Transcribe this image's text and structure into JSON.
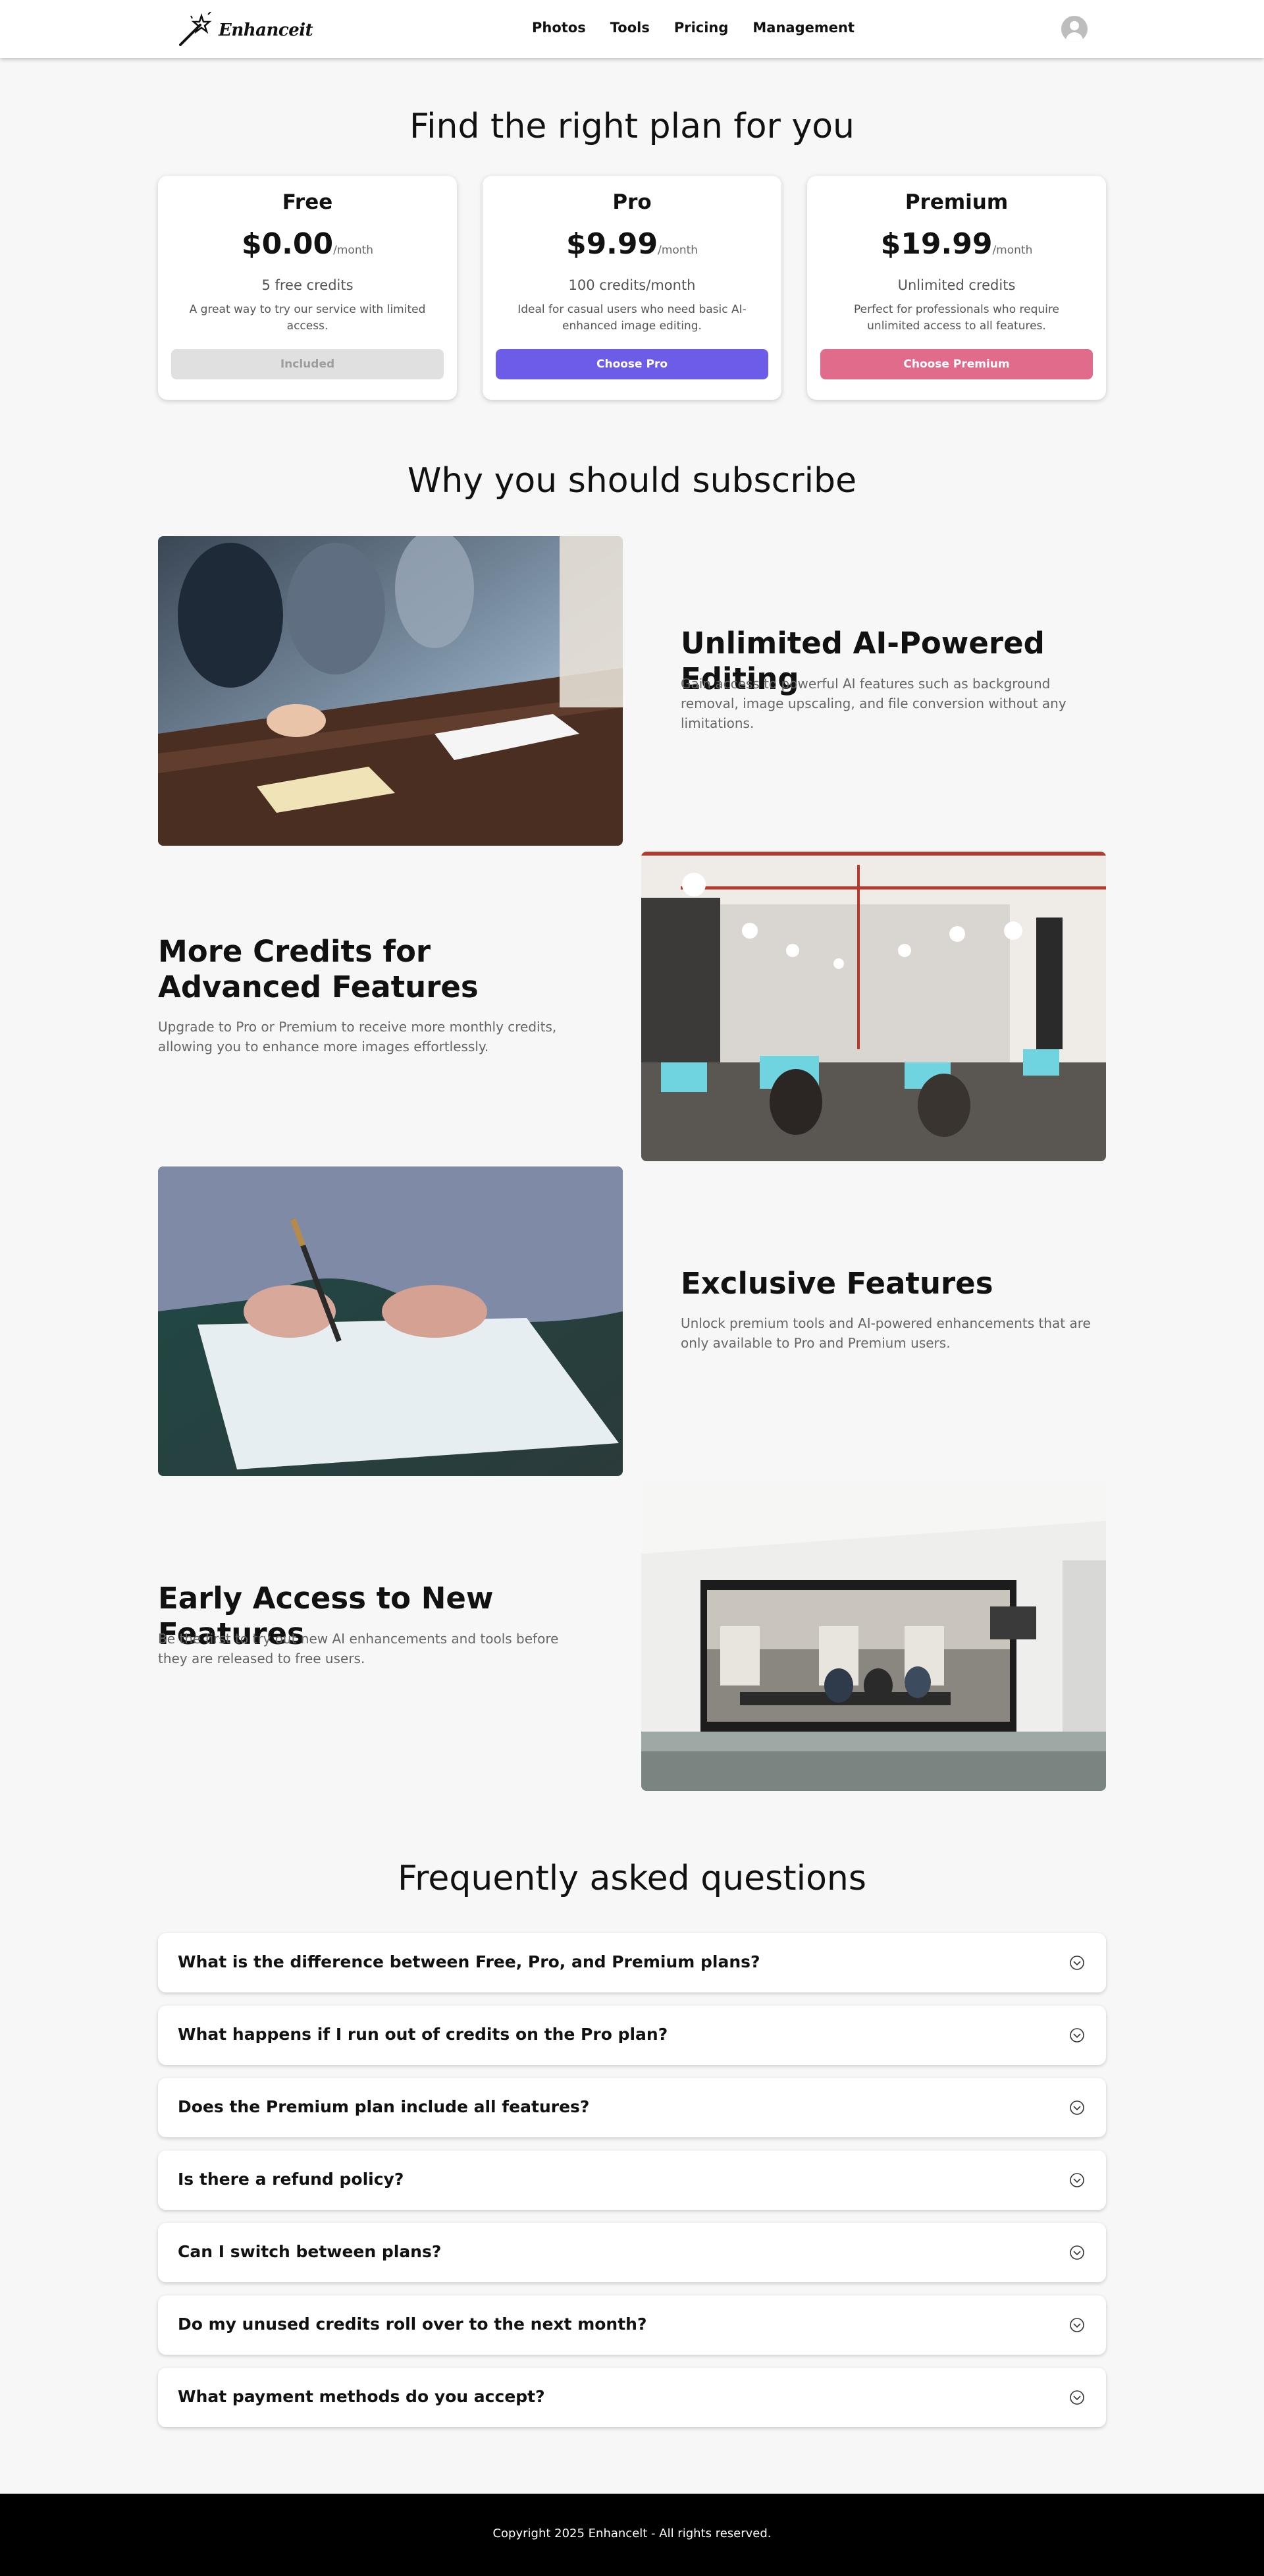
{
  "nav": {
    "brand": "Enhanceit",
    "links": [
      "Photos",
      "Tools",
      "Pricing",
      "Management"
    ]
  },
  "pricing": {
    "heading": "Find the right plan for you",
    "plans": [
      {
        "name": "Free",
        "price": "$0.00",
        "period": "/month",
        "credits": "5 free credits",
        "desc": "A great way to try our service with limited access.",
        "button": "Included",
        "button_color": "#e0e0e0",
        "button_text_color": "#9e9e9e"
      },
      {
        "name": "Pro",
        "price": "$9.99",
        "period": "/month",
        "credits": "100 credits/month",
        "desc": "Ideal for casual users who need basic AI-enhanced image editing.",
        "button": "Choose Pro",
        "button_color": "#6c5ce7",
        "button_text_color": "#ffffff"
      },
      {
        "name": "Premium",
        "price": "$19.99",
        "period": "/month",
        "credits": "Unlimited credits",
        "desc": "Perfect for professionals who require unlimited access to all features.",
        "button": "Choose Premium",
        "button_color": "#e06b8b",
        "button_text_color": "#ffffff"
      }
    ]
  },
  "why": {
    "heading": "Why you should subscribe",
    "features": [
      {
        "title": "Unlimited AI-Powered Editing",
        "desc": "Gain access to powerful AI features such as background removal, image upscaling, and file conversion without any limitations."
      },
      {
        "title": "More Credits for Advanced Features",
        "desc": "Upgrade to Pro or Premium to receive more monthly credits, allowing you to enhance more images effortlessly."
      },
      {
        "title": "Exclusive Features",
        "desc": "Unlock premium tools and AI-powered enhancements that are only available to Pro and Premium users."
      },
      {
        "title": "Early Access to New Features",
        "desc": "Be the first to try out new AI enhancements and tools before they are released to free users."
      }
    ]
  },
  "faq": {
    "heading": "Frequently asked questions",
    "questions": [
      "What is the difference between Free, Pro, and Premium plans?",
      "What happens if I run out of credits on the Pro plan?",
      "Does the Premium plan include all features?",
      "Is there a refund policy?",
      "Can I switch between plans?",
      "Do my unused credits roll over to the next month?",
      "What payment methods do you accept?"
    ]
  },
  "footer": {
    "copyright": "Copyright 2025 Enhancelt - All rights reserved."
  }
}
